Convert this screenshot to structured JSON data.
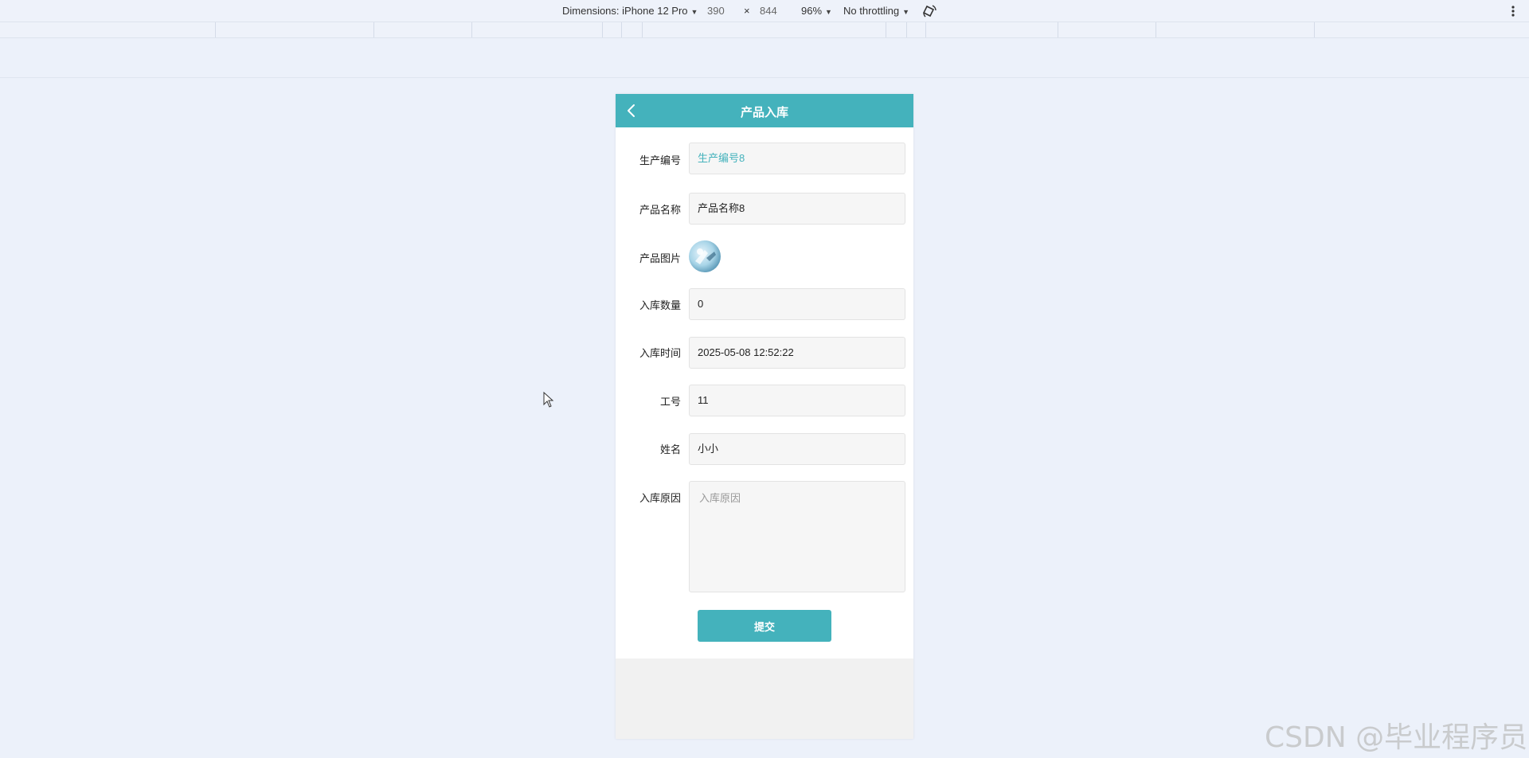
{
  "devtools": {
    "dimensions_label": "Dimensions: iPhone 12 Pro",
    "width": "390",
    "times": "×",
    "height": "844",
    "zoom": "96%",
    "throttling": "No throttling"
  },
  "page": {
    "title": "产品入库",
    "fields": {
      "production_no": {
        "label": "生产编号",
        "value": "生产编号8"
      },
      "product_name": {
        "label": "产品名称",
        "value": "产品名称8"
      },
      "product_image": {
        "label": "产品图片"
      },
      "quantity": {
        "label": "入库数量",
        "value": "0"
      },
      "time": {
        "label": "入库时间",
        "value": "2025-05-08 12:52:22"
      },
      "employee_no": {
        "label": "工号",
        "value": "11"
      },
      "name": {
        "label": "姓名",
        "value": "小小"
      },
      "reason": {
        "label": "入库原因",
        "placeholder": "入库原因"
      }
    },
    "submit_label": "提交"
  },
  "watermark": "CSDN @毕业程序员",
  "colors": {
    "accent": "#44b2bc",
    "background": "#ecf1fa"
  }
}
